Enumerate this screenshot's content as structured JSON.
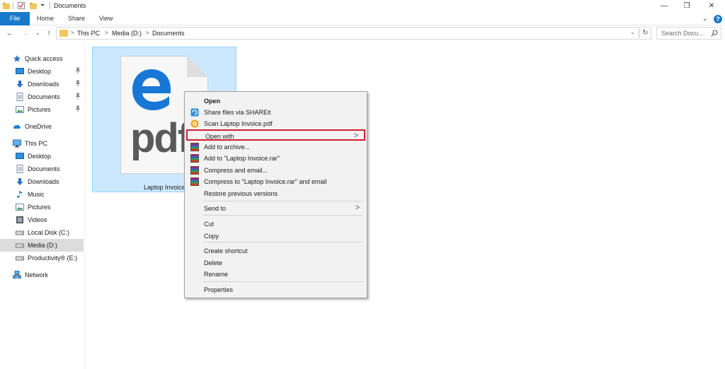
{
  "window": {
    "title": "Documents",
    "minimize": "—",
    "restore": "❐",
    "close": "✕"
  },
  "ribbon": {
    "tabs": [
      "File",
      "Home",
      "Share",
      "View"
    ],
    "expand": "⌄",
    "help": "?"
  },
  "nav": {
    "back": "←",
    "forward": "→",
    "recent": "⌄",
    "up": "↑",
    "breadcrumbs": [
      "This PC",
      "Media (D:)",
      "Documents"
    ],
    "crumb_sep": ">",
    "refresh": "↻",
    "search_placeholder": "Search Docu..."
  },
  "sidebar": {
    "items": [
      {
        "label": "Quick access",
        "icon": "star-icon"
      },
      {
        "label": "Desktop",
        "icon": "desktop-icon",
        "pinned": true
      },
      {
        "label": "Downloads",
        "icon": "downloads-icon",
        "pinned": true
      },
      {
        "label": "Documents",
        "icon": "documents-icon",
        "pinned": true
      },
      {
        "label": "Pictures",
        "icon": "pictures-icon",
        "pinned": true
      },
      {
        "label": "OneDrive",
        "icon": "cloud-icon"
      },
      {
        "label": "This PC",
        "icon": "computer-icon"
      },
      {
        "label": "Desktop",
        "icon": "desktop-icon"
      },
      {
        "label": "Documents",
        "icon": "documents-icon"
      },
      {
        "label": "Downloads",
        "icon": "downloads-icon"
      },
      {
        "label": "Music",
        "icon": "music-icon"
      },
      {
        "label": "Pictures",
        "icon": "pictures-icon"
      },
      {
        "label": "Videos",
        "icon": "videos-icon"
      },
      {
        "label": "Local Disk (C:)",
        "icon": "drive-icon"
      },
      {
        "label": "Media (D:)",
        "icon": "drive-icon",
        "selected": true
      },
      {
        "label": "Productivity® (E:)",
        "icon": "drive-icon"
      },
      {
        "label": "Network",
        "icon": "network-icon"
      }
    ],
    "pin_glyph": "📌"
  },
  "file": {
    "name": "Laptop Invoice",
    "badge": "pdf"
  },
  "context_menu": {
    "items": [
      {
        "label": "Open",
        "bold": true
      },
      {
        "label": "Share files via SHAREit",
        "icon": "shareit-icon"
      },
      {
        "label": "Scan Laptop Invoice.pdf",
        "icon": "scan-icon"
      },
      {
        "label": "Open with",
        "submenu": true,
        "highlighted": true
      },
      {
        "label": "Add to archive...",
        "icon": "winrar-icon"
      },
      {
        "label": "Add to \"Laptop Invoice.rar\"",
        "icon": "winrar-icon"
      },
      {
        "label": "Compress and email...",
        "icon": "winrar-icon"
      },
      {
        "label": "Compress to \"Laptop Invoice.rar\" and email",
        "icon": "winrar-icon"
      },
      {
        "label": "Restore previous versions"
      },
      {
        "label": "Send to",
        "submenu": true
      },
      {
        "label": "Cut"
      },
      {
        "label": "Copy"
      },
      {
        "label": "Create shortcut"
      },
      {
        "label": "Delete"
      },
      {
        "label": "Rename"
      },
      {
        "label": "Properties"
      }
    ],
    "arrow": ">"
  },
  "colors": {
    "accent": "#1979ca",
    "selection": "#cce8ff",
    "highlight_border": "#d21f2a"
  }
}
